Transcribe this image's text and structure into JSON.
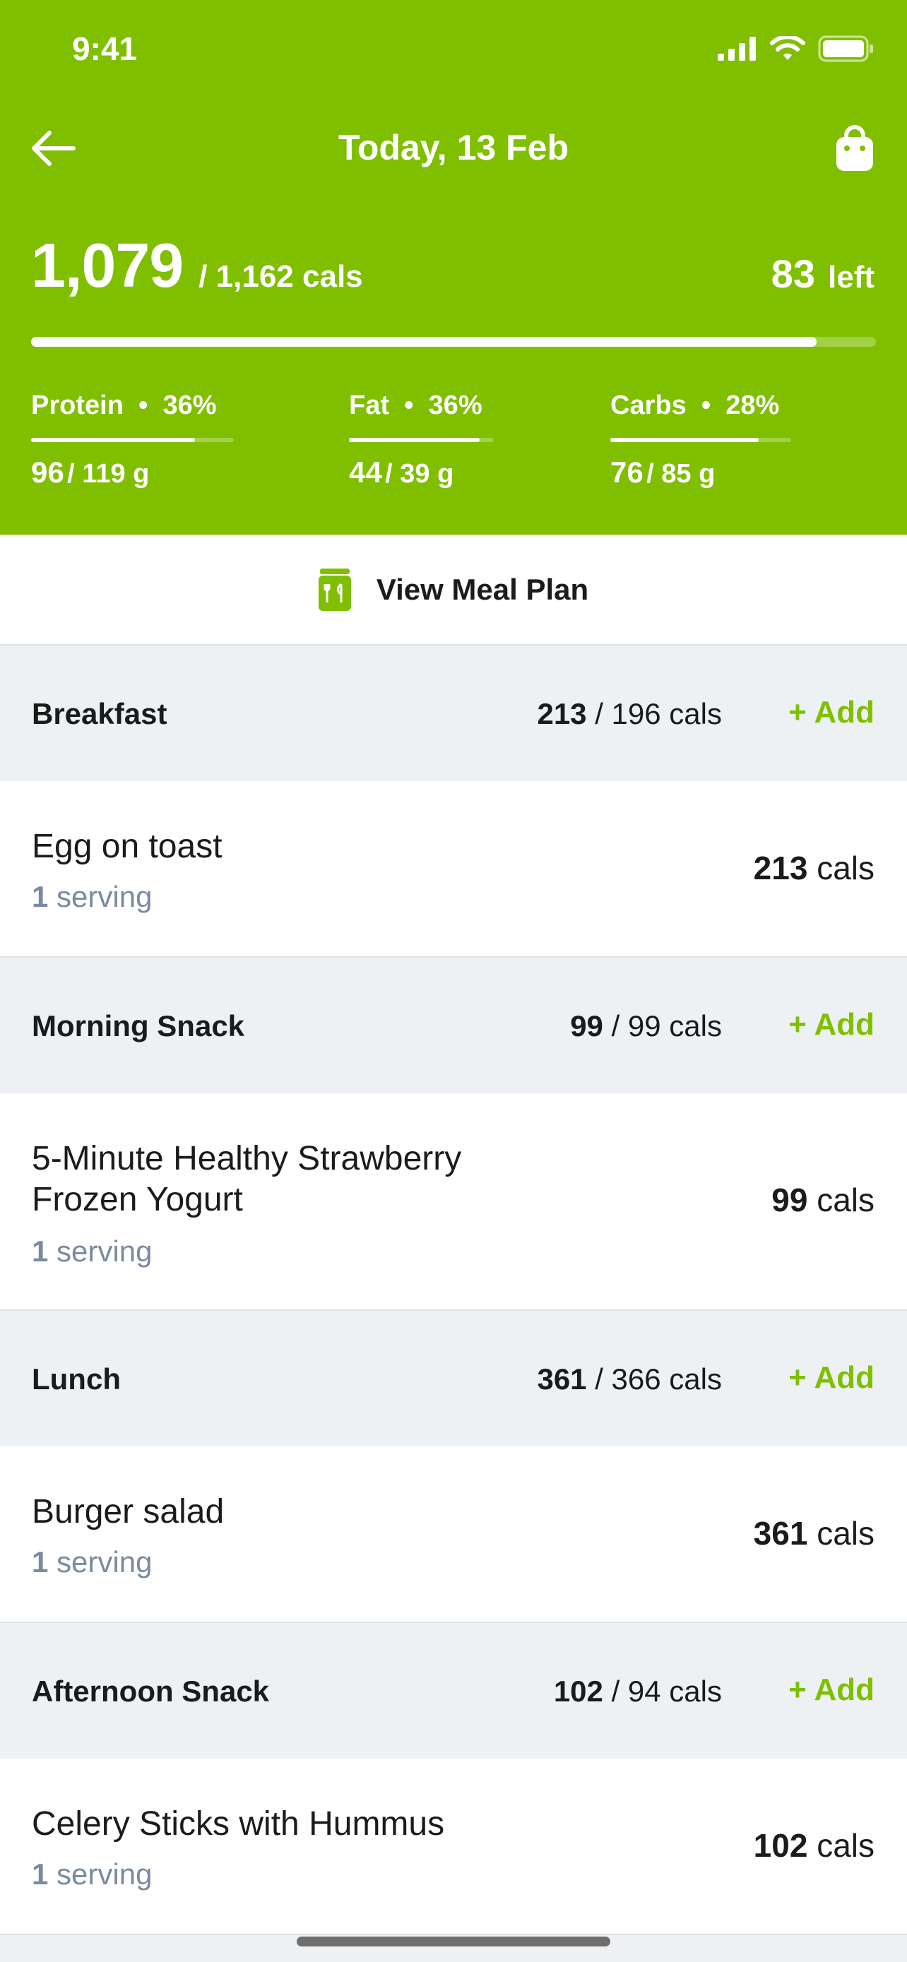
{
  "status_bar": {
    "time": "9:41"
  },
  "nav": {
    "title": "Today, 13 Feb"
  },
  "summary": {
    "calories_eaten": "1,079",
    "calories_goal": "/ 1,162 cals",
    "calories_left": "83",
    "left_label": "left",
    "progress": 0.93
  },
  "macros": [
    {
      "name": "Protein",
      "percent": "36%",
      "eaten": "96",
      "goal": "/ 119 g",
      "progress": 0.81
    },
    {
      "name": "Fat",
      "percent": "36%",
      "eaten": "44",
      "goal": "/ 39 g",
      "progress": 0.9
    },
    {
      "name": "Carbs",
      "percent": "28%",
      "eaten": "76",
      "goal": "/ 85 g",
      "progress": 0.82
    }
  ],
  "meal_plan": {
    "label": "View Meal Plan"
  },
  "add_label": "+ Add",
  "meals": [
    {
      "title": "Breakfast",
      "eaten": "213",
      "target": "/ 196 cals",
      "item": {
        "name": "Egg on toast",
        "qty": "1",
        "unit": "serving",
        "cals": "213",
        "cals_unit": "cals"
      }
    },
    {
      "title": "Morning Snack",
      "eaten": "99",
      "target": "/ 99 cals",
      "item": {
        "name": "5-Minute Healthy Strawberry Frozen Yogurt",
        "qty": "1",
        "unit": "serving",
        "cals": "99",
        "cals_unit": "cals"
      }
    },
    {
      "title": "Lunch",
      "eaten": "361",
      "target": "/ 366 cals",
      "item": {
        "name": "Burger salad",
        "qty": "1",
        "unit": "serving",
        "cals": "361",
        "cals_unit": "cals"
      }
    },
    {
      "title": "Afternoon Snack",
      "eaten": "102",
      "target": "/ 94 cals",
      "item": {
        "name": "Celery Sticks with Hummus",
        "qty": "1",
        "unit": "serving",
        "cals": "102",
        "cals_unit": "cals"
      }
    }
  ],
  "colors": {
    "brand_green": "#7fbf00",
    "muted_text": "#7a8aa0",
    "section_bg": "#eef1f4"
  },
  "icons": {
    "back": "arrow-left-icon",
    "bag": "shopping-bag-icon",
    "meal_plan": "meal-plan-icon"
  }
}
